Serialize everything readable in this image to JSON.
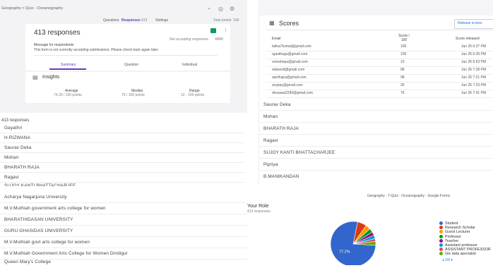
{
  "topleft": {
    "breadcrumb": "Geography > Quiz - Oceanography",
    "tabs": [
      "Questions",
      "Responses",
      "Settings"
    ],
    "responses_count_badge": "413",
    "total_points": "Total points: 100",
    "responses_title": "413 responses",
    "accepting_label": "Not accepting responses",
    "message_label": "Message for respondents",
    "message_text": "This form is not currently accepting submissions. Please check back again later.",
    "view_tabs": [
      "Summary",
      "Question",
      "Individual"
    ],
    "insights_title": "Insights",
    "stats": [
      {
        "label": "Average",
        "value": "74.33 / 100 points"
      },
      {
        "label": "Median",
        "value": "79 / 100 points"
      },
      {
        "label": "Range",
        "value": "12 - 100 points"
      }
    ]
  },
  "scores": {
    "title": "Scores",
    "release_btn": "Release scores",
    "col_email": "Email",
    "col_score": "Score / 100",
    "col_released": "Score released",
    "rows": [
      {
        "email": "tulika7kumal@gmail.com",
        "score": "100",
        "released": "Jun 26 6:37 PM"
      },
      {
        "email": "rgauthagu@gmail.com",
        "score": "100",
        "released": "Jun 26 6:39 PM"
      },
      {
        "email": "vsmahepa@gmail.com",
        "score": "10",
        "released": "Jun 26 6:53 PM"
      },
      {
        "email": "selpavid@gmail.com",
        "score": "68",
        "released": "Jun 26 7:28 PM"
      },
      {
        "email": "aanthapa@gmail.com",
        "score": "98",
        "released": "Jun 26 7:21 PM"
      },
      {
        "email": "avypay@gmail.com",
        "score": "30",
        "released": "Jun 26 7:23 PM"
      },
      {
        "email": "devaasa2290@gmail.com",
        "score": "76",
        "released": "Jun 26 7:41 PM"
      }
    ]
  },
  "names_left": {
    "header": "413 responses",
    "items": [
      "Gayathri",
      "H.RIZWANA",
      "Saurav Deka",
      "Mohan",
      "BHARATH RAJA",
      "Ragavi",
      "SUJOY KANTI BHATTACHARJEE"
    ]
  },
  "names_right": {
    "items": [
      "Saurav Deka",
      "Mohan",
      "BHARATH RAJA",
      "Ragavi",
      "SUJOY KANTI BHATTACHARJEE",
      "Pipriya",
      "B.MANIKANDAN"
    ]
  },
  "institutions": {
    "items": [
      "Acharya Nagarjuna University",
      "M.V.Muthiah government arts college for women",
      "BHARATHIDASAN UNIVERSITY",
      "GURU GHASIDAS UNIVERSITY",
      "M.V.Muthiah govt arts college for women",
      "M.V.Muthiah Government Arts College for Women Dindigul",
      "Queen Mary's College"
    ]
  },
  "role_chart_panel": {
    "window_title": "Geography - T-Quiz - Oceanography - Google Forms",
    "question_title": "Your Role",
    "responses": "413 responses",
    "pager": "1/6",
    "chart_data": {
      "type": "pie",
      "slices": [
        {
          "name": "Student",
          "value": 77.2,
          "color": "#3366cc"
        },
        {
          "name": "Research Scholar",
          "value": 6.5,
          "color": "#dc3912"
        },
        {
          "name": "Guest Lecturer",
          "value": 3.5,
          "color": "#ff9900"
        },
        {
          "name": "Professor",
          "value": 3.0,
          "color": "#109618"
        },
        {
          "name": "Teacher",
          "value": 2.5,
          "color": "#990099"
        },
        {
          "name": "Assistant professor",
          "value": 2.5,
          "color": "#0099c6"
        },
        {
          "name": "ASSISTANT PROFESSOR",
          "value": 2.0,
          "color": "#dd4477"
        },
        {
          "name": "Gis data specialist",
          "value": 2.8,
          "color": "#66aa00"
        }
      ],
      "slice_label": "77.2%"
    }
  }
}
